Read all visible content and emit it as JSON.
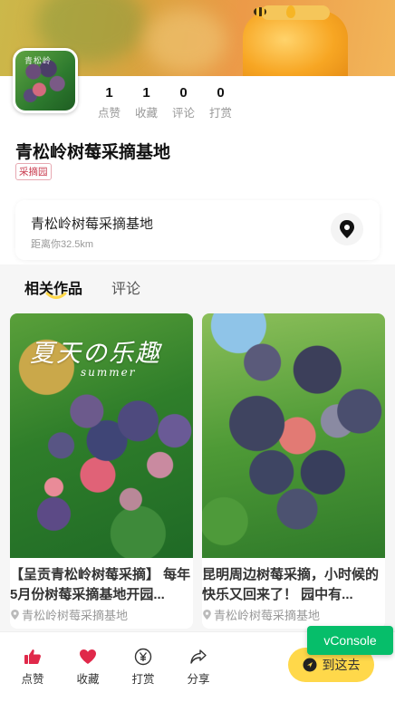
{
  "profile": {
    "name": "青松岭树莓采摘基地",
    "tag": "采摘园",
    "avatar_text": "青松岭",
    "stats": [
      {
        "value": "1",
        "label": "点赞"
      },
      {
        "value": "1",
        "label": "收藏"
      },
      {
        "value": "0",
        "label": "评论"
      },
      {
        "value": "0",
        "label": "打赏"
      }
    ]
  },
  "location": {
    "name": "青松岭树莓采摘基地",
    "distance": "距离你32.5km"
  },
  "tabs": [
    {
      "label": "相关作品",
      "active": true
    },
    {
      "label": "评论",
      "active": false
    }
  ],
  "feed": [
    {
      "title": "【呈贡青松岭树莓采摘】 每年5月份树莓采摘基地开园...",
      "location": "青松岭树莓采摘基地",
      "photo_caption": "夏天の乐趣",
      "photo_subcaption": "summer"
    },
    {
      "title": "昆明周边树莓采摘，小时候的快乐又回来了！ 园中有...",
      "location": "青松岭树莓采摘基地"
    }
  ],
  "bottom_bar": {
    "like": "点赞",
    "collect": "收藏",
    "tip": "打赏",
    "share": "分享",
    "go": "到这去"
  },
  "vconsole": "vConsole",
  "colors": {
    "accent_yellow": "#ffd84a",
    "like_red": "#e0294a",
    "vconsole_green": "#06be6a"
  }
}
